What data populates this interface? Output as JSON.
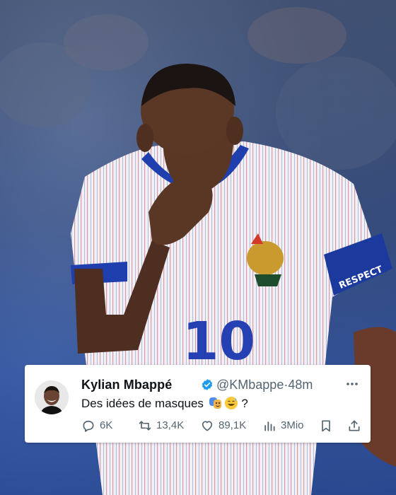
{
  "tweet": {
    "name": "Kylian Mbappé",
    "handle": "@KMbappe",
    "separator": "·",
    "time": "48m",
    "text_before": "Des idées de masques ",
    "text_after": " ?",
    "emojis": [
      "performing-arts",
      "grinning-sweat"
    ],
    "verified_color": "#1d9bf0"
  },
  "actions": {
    "replies": "6K",
    "retweets": "13,4K",
    "likes": "89,1K",
    "views": "3Mio"
  },
  "photo": {
    "jersey_number": "10",
    "armband_text": "RESPECT"
  },
  "colors": {
    "text": "#0f1419",
    "muted": "#536471",
    "card": "#ffffff"
  }
}
